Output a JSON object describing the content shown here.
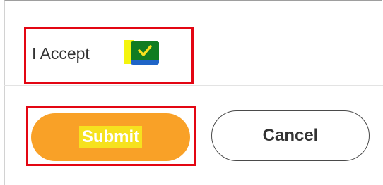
{
  "acceptance": {
    "label": "I Accept",
    "checked": true,
    "checkbox_color": "#0f7c21"
  },
  "actions": {
    "submit_label": "Submit",
    "cancel_label": "Cancel",
    "submit_color": "#f9a127"
  },
  "annotations": {
    "highlight_color": "#e30613"
  }
}
